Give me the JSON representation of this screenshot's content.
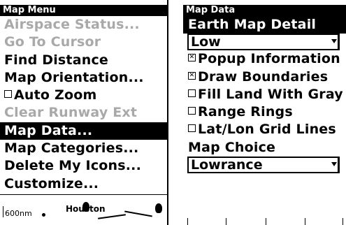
{
  "map_menu": {
    "title": "Map Menu",
    "items": [
      {
        "label": "Airspace Status...",
        "state": "disabled"
      },
      {
        "label": "Go To Cursor",
        "state": "disabled"
      },
      {
        "label": "Find Distance",
        "state": "normal"
      },
      {
        "label": "Map Orientation...",
        "state": "normal"
      },
      {
        "label": "Auto Zoom",
        "state": "normal",
        "checked": false
      },
      {
        "label": "Clear Runway Ext",
        "state": "disabled"
      },
      {
        "label": "Map Data...",
        "state": "selected"
      },
      {
        "label": "Map Categories...",
        "state": "normal"
      },
      {
        "label": "Delete My Icons...",
        "state": "normal"
      },
      {
        "label": "Customize...",
        "state": "normal"
      }
    ]
  },
  "map_preview": {
    "scale": "600nm",
    "city": "Houston"
  },
  "map_data": {
    "title": "Map Data",
    "earth_map_detail_label": "Earth Map Detail",
    "earth_map_detail_value": "Low",
    "options": [
      {
        "label": "Popup Information",
        "checked": true
      },
      {
        "label": "Draw Boundaries",
        "checked": true
      },
      {
        "label": "Fill Land With Gray",
        "checked": false
      },
      {
        "label": "Range Rings",
        "checked": false
      },
      {
        "label": "Lat/Lon Grid Lines",
        "checked": false
      }
    ],
    "map_choice_label": "Map Choice",
    "map_choice_value": "Lowrance"
  },
  "colors": {
    "background": "#ffffff",
    "text": "#000000",
    "disabled": "#a9a9a9",
    "highlight": "#000000"
  }
}
